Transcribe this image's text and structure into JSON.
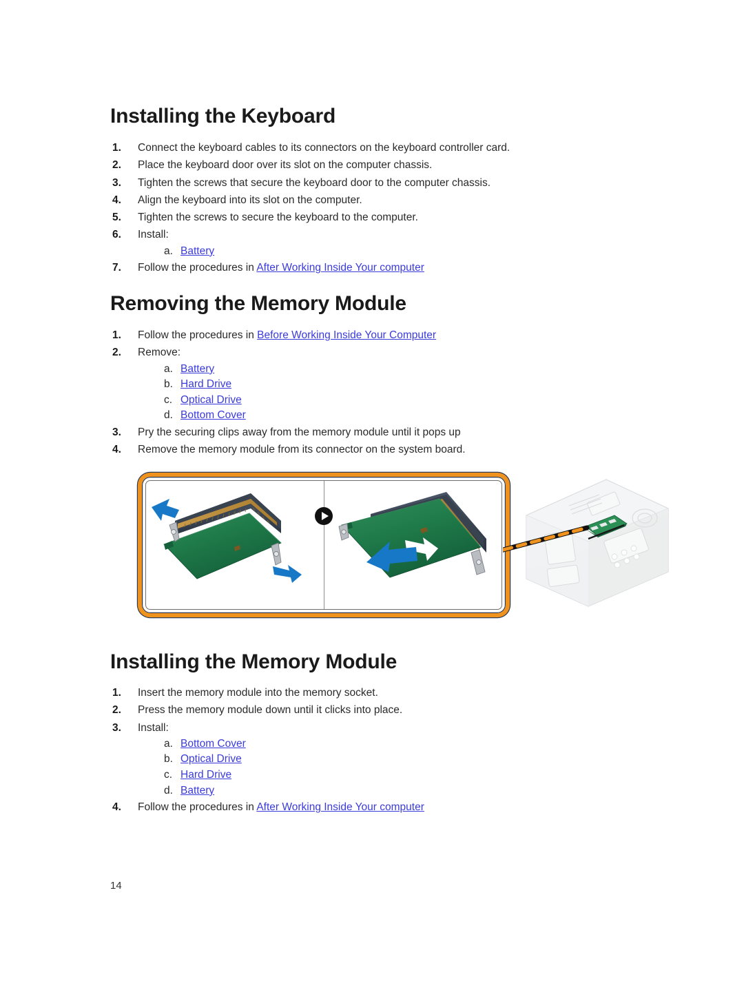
{
  "document": {
    "page_number": "14"
  },
  "sections": [
    {
      "id": "installing-keyboard",
      "heading": "Installing the Keyboard",
      "steps": [
        {
          "num": "1.",
          "text": "Connect the keyboard cables to its connectors on the keyboard controller card."
        },
        {
          "num": "2.",
          "text": "Place the keyboard door over its slot on the computer chassis."
        },
        {
          "num": "3.",
          "text": "Tighten the screws that secure the keyboard door to the computer chassis."
        },
        {
          "num": "4.",
          "text": "Align the keyboard into its slot on the computer."
        },
        {
          "num": "5.",
          "text": "Tighten the screws to secure the keyboard to the computer."
        },
        {
          "num": "6.",
          "text": "Install:",
          "sub": [
            {
              "letter": "a.",
              "link": "Battery"
            }
          ]
        },
        {
          "num": "7.",
          "text": "Follow the procedures in ",
          "link": "After Working Inside Your computer"
        }
      ]
    },
    {
      "id": "removing-memory-module",
      "heading": "Removing the Memory Module",
      "steps": [
        {
          "num": "1.",
          "text": "Follow the procedures in ",
          "link": "Before Working Inside Your Computer"
        },
        {
          "num": "2.",
          "text": "Remove:",
          "sub": [
            {
              "letter": "a.",
              "link": "Battery"
            },
            {
              "letter": "b.",
              "link": "Hard Drive"
            },
            {
              "letter": "c.",
              "link": "Optical Drive"
            },
            {
              "letter": "d.",
              "link": "Bottom Cover"
            }
          ]
        },
        {
          "num": "3.",
          "text": "Pry the securing clips away from the memory module until it pops up"
        },
        {
          "num": "4.",
          "text": "Remove the memory module from its connector on the system board."
        }
      ]
    },
    {
      "id": "installing-memory-module",
      "heading": "Installing the Memory Module",
      "steps": [
        {
          "num": "1.",
          "text": "Insert the memory module into the memory socket."
        },
        {
          "num": "2.",
          "text": "Press the memory module down until it clicks into place."
        },
        {
          "num": "3.",
          "text": "Install:",
          "sub": [
            {
              "letter": "a.",
              "link": "Bottom Cover"
            },
            {
              "letter": "b.",
              "link": "Optical Drive"
            },
            {
              "letter": "c.",
              "link": "Hard Drive"
            },
            {
              "letter": "d.",
              "link": "Battery"
            }
          ]
        },
        {
          "num": "4.",
          "text": "Follow the procedures in ",
          "link": "After Working Inside Your computer"
        }
      ]
    }
  ],
  "figure": {
    "caption": "",
    "frame_border_color": "#f0921e",
    "arrow_color": "#1878c8",
    "pcb_color": "#1f7a4a",
    "socket_color": "#3a4556",
    "leader_line_color": "#f0921e",
    "panels": [
      {
        "label": "pry-clips-panel",
        "arrows": [
          "up-left",
          "down-right"
        ]
      },
      {
        "label": "remove-module-panel",
        "arrows": [
          "down-left"
        ]
      }
    ],
    "badge_icon": "play-icon"
  }
}
